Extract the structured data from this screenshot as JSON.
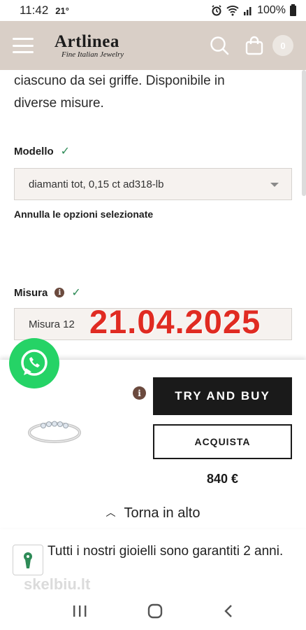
{
  "status_bar": {
    "time": "11:42",
    "temperature": "21°",
    "battery": "100%"
  },
  "header": {
    "logo_main": "Artlinea",
    "logo_sub": "Fine Italian Jewelry",
    "cart_count": "0",
    "bg_color": "#d9cfc7"
  },
  "product": {
    "description_line1": "ciascuno da sei griffe. Disponibile in",
    "description_line2": "diverse misure.",
    "model_label": "Modello",
    "model_value": "diamanti tot, 0,15 ct ad318-lb",
    "reset_label": "Annulla le opzioni selezionate",
    "size_label": "Misura",
    "size_value": "Misura 12"
  },
  "overlay": {
    "date_stamp": "21.04.2025",
    "stamp_color": "#e02b22"
  },
  "purchase": {
    "try_button": "TRY AND BUY",
    "buy_button": "ACQUISTA",
    "price": "840 €",
    "info_icon_glyph": "i"
  },
  "footer": {
    "back_to_top": "Torna in alto",
    "guarantee_text": "Tutti i nostri gioielli sono garantiti 2 anni.",
    "watermark": "skelbiu.lt"
  },
  "icons": {
    "menu": "hamburger-icon",
    "search": "search-icon",
    "cart": "shopping-bag-icon",
    "whatsapp": "whatsapp-icon",
    "info": "info-icon",
    "lock": "keyhole-lock-icon"
  },
  "colors": {
    "check": "#2e8b57",
    "whatsapp": "#25d366",
    "primary_button": "#1a1a1a"
  }
}
